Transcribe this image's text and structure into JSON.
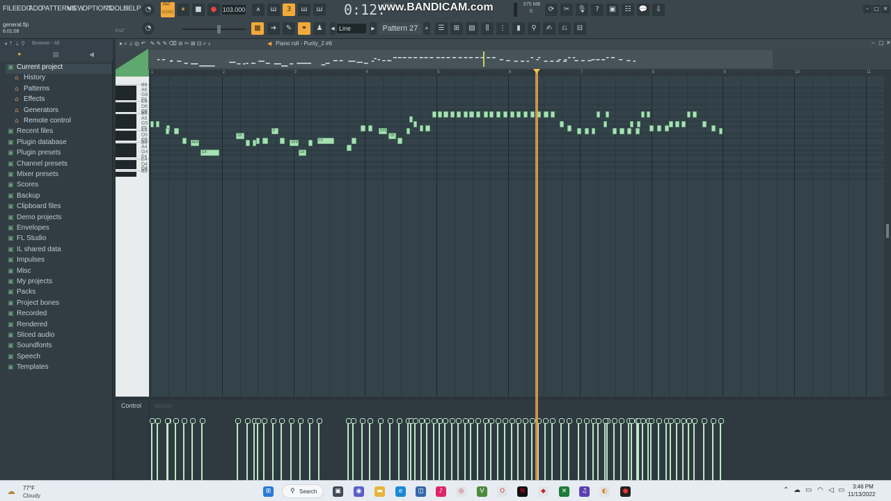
{
  "menu": [
    "FILE",
    "EDIT",
    "ADD",
    "PATTERNS",
    "VIEW",
    "OPTIONS",
    "TOOLS",
    "HELP"
  ],
  "transport": {
    "pat_label": "PAT",
    "song_label": "SONG",
    "tempo": "103.000",
    "time": "0:12:",
    "time_sub": "M:S:CS",
    "memory": "575 MB",
    "memory_sub": "0"
  },
  "watermark": "www.BANDICAM.com",
  "project": {
    "file": "general.flp",
    "position": "6:01:08",
    "hint_time": "0'12''"
  },
  "toolbar2": {
    "snap": "Line",
    "pattern": "Pattern 27"
  },
  "browser": {
    "header": "Browser - All",
    "items": [
      {
        "label": "Current project",
        "type": "root"
      },
      {
        "label": "History",
        "type": "sub"
      },
      {
        "label": "Patterns",
        "type": "sub"
      },
      {
        "label": "Effects",
        "type": "sub"
      },
      {
        "label": "Generators",
        "type": "sub"
      },
      {
        "label": "Remote control",
        "type": "sub"
      },
      {
        "label": "Recent files",
        "type": "root"
      },
      {
        "label": "Plugin database",
        "type": "root"
      },
      {
        "label": "Plugin presets",
        "type": "root"
      },
      {
        "label": "Channel presets",
        "type": "root"
      },
      {
        "label": "Mixer presets",
        "type": "root"
      },
      {
        "label": "Scores",
        "type": "root"
      },
      {
        "label": "Backup",
        "type": "root"
      },
      {
        "label": "Clipboard files",
        "type": "root"
      },
      {
        "label": "Demo projects",
        "type": "root"
      },
      {
        "label": "Envelopes",
        "type": "root"
      },
      {
        "label": "FL Studio",
        "type": "root"
      },
      {
        "label": "IL shared data",
        "type": "root"
      },
      {
        "label": "Impulses",
        "type": "root"
      },
      {
        "label": "Misc",
        "type": "root"
      },
      {
        "label": "My projects",
        "type": "root"
      },
      {
        "label": "Packs",
        "type": "root"
      },
      {
        "label": "Project bones",
        "type": "root"
      },
      {
        "label": "Recorded",
        "type": "root"
      },
      {
        "label": "Rendered",
        "type": "root"
      },
      {
        "label": "Sliced audio",
        "type": "root"
      },
      {
        "label": "Soundfonts",
        "type": "root"
      },
      {
        "label": "Speech",
        "type": "root"
      },
      {
        "label": "Templates",
        "type": "root"
      }
    ]
  },
  "piano_roll": {
    "title": "Piano roll - Purity_2 #6",
    "bars": [
      "1",
      "2",
      "3",
      "4",
      "5",
      "6",
      "7",
      "8",
      "9",
      "10",
      "11"
    ],
    "key_labels": [
      "B6",
      "A6",
      "G6",
      "F6",
      "E6",
      "D6",
      "C6",
      "B5",
      "A5",
      "G5",
      "F5",
      "E5",
      "D5",
      "C5",
      "B4",
      "A4",
      "G4",
      "F4",
      "E4",
      "D4",
      "C4",
      "B3"
    ],
    "playhead_bar": 6.4,
    "notes": [
      {
        "label": "",
        "bar": 1.0,
        "len": 0.04,
        "pitch": "G5"
      },
      {
        "label": "",
        "bar": 1.08,
        "len": 0.05,
        "pitch": "G5"
      },
      {
        "label": "",
        "bar": 1.22,
        "len": 0.04,
        "pitch": "F5"
      },
      {
        "label": "",
        "bar": 1.21,
        "len": 0.04,
        "pitch": "E5"
      },
      {
        "label": "",
        "bar": 1.33,
        "len": 0.07,
        "pitch": "E5"
      },
      {
        "label": "",
        "bar": 1.45,
        "len": 0.06,
        "pitch": "C5"
      },
      {
        "label": "A#4",
        "bar": 1.56,
        "len": 0.12,
        "pitch": "B4"
      },
      {
        "label": "G4",
        "bar": 1.7,
        "len": 0.26,
        "pitch": "G4"
      },
      {
        "label": "D5",
        "bar": 2.2,
        "len": 0.11,
        "pitch": "D5"
      },
      {
        "label": "",
        "bar": 2.33,
        "len": 0.06,
        "pitch": "B4"
      },
      {
        "label": "",
        "bar": 2.43,
        "len": 0.04,
        "pitch": "B4"
      },
      {
        "label": "",
        "bar": 2.48,
        "len": 0.04,
        "pitch": "C5"
      },
      {
        "label": "",
        "bar": 2.57,
        "len": 0.07,
        "pitch": "C5"
      },
      {
        "label": "D",
        "bar": 2.69,
        "len": 0.1,
        "pitch": "E5"
      },
      {
        "label": "",
        "bar": 2.81,
        "len": 0.07,
        "pitch": "C5"
      },
      {
        "label": "A#4",
        "bar": 2.95,
        "len": 0.12,
        "pitch": "B4"
      },
      {
        "label": "G4",
        "bar": 3.07,
        "len": 0.11,
        "pitch": "G4"
      },
      {
        "label": "",
        "bar": 3.21,
        "len": 0.06,
        "pitch": "B4"
      },
      {
        "label": "C5",
        "bar": 3.33,
        "len": 0.24,
        "pitch": "C5"
      },
      {
        "label": "",
        "bar": 3.74,
        "len": 0.07,
        "pitch": "A4"
      },
      {
        "label": "",
        "bar": 3.81,
        "len": 0.07,
        "pitch": "C5"
      },
      {
        "label": "",
        "bar": 3.94,
        "len": 0.07,
        "pitch": "F5"
      },
      {
        "label": "",
        "bar": 4.04,
        "len": 0.06,
        "pitch": "F5"
      },
      {
        "label": "D#5",
        "bar": 4.19,
        "len": 0.12,
        "pitch": "E5"
      },
      {
        "label": "D5",
        "bar": 4.33,
        "len": 0.1,
        "pitch": "D5"
      },
      {
        "label": "",
        "bar": 4.45,
        "len": 0.07,
        "pitch": "C5"
      },
      {
        "label": "",
        "bar": 4.58,
        "len": 0.04,
        "pitch": "E5"
      },
      {
        "label": "",
        "bar": 4.62,
        "len": 0.04,
        "pitch": "A5"
      },
      {
        "label": "",
        "bar": 4.68,
        "len": 0.04,
        "pitch": "G5"
      },
      {
        "label": "",
        "bar": 4.76,
        "len": 0.05,
        "pitch": "F5"
      },
      {
        "label": "",
        "bar": 4.84,
        "len": 0.07,
        "pitch": "F5"
      },
      {
        "label": "",
        "bar": 4.94,
        "len": 0.06,
        "pitch": "B5"
      },
      {
        "label": "",
        "bar": 5.02,
        "len": 0.06,
        "pitch": "B5"
      },
      {
        "label": "",
        "bar": 5.1,
        "len": 0.06,
        "pitch": "B5"
      },
      {
        "label": "",
        "bar": 5.19,
        "len": 0.06,
        "pitch": "B5"
      },
      {
        "label": "",
        "bar": 5.28,
        "len": 0.06,
        "pitch": "B5"
      },
      {
        "label": "",
        "bar": 5.38,
        "len": 0.06,
        "pitch": "B5"
      },
      {
        "label": "",
        "bar": 5.46,
        "len": 0.06,
        "pitch": "B5"
      },
      {
        "label": "",
        "bar": 5.55,
        "len": 0.06,
        "pitch": "B5"
      },
      {
        "label": "",
        "bar": 5.66,
        "len": 0.06,
        "pitch": "B5"
      },
      {
        "label": "",
        "bar": 5.74,
        "len": 0.06,
        "pitch": "B5"
      },
      {
        "label": "",
        "bar": 5.83,
        "len": 0.06,
        "pitch": "B5"
      },
      {
        "label": "",
        "bar": 5.93,
        "len": 0.06,
        "pitch": "B5"
      },
      {
        "label": "",
        "bar": 6.03,
        "len": 0.06,
        "pitch": "B5"
      },
      {
        "label": "",
        "bar": 6.12,
        "len": 0.06,
        "pitch": "B5"
      },
      {
        "label": "",
        "bar": 6.21,
        "len": 0.06,
        "pitch": "B5"
      },
      {
        "label": "",
        "bar": 6.31,
        "len": 0.06,
        "pitch": "B5"
      },
      {
        "label": "",
        "bar": 6.4,
        "len": 0.06,
        "pitch": "B5"
      },
      {
        "label": "",
        "bar": 6.5,
        "len": 0.06,
        "pitch": "B5"
      },
      {
        "label": "",
        "bar": 6.59,
        "len": 0.06,
        "pitch": "B5"
      },
      {
        "label": "",
        "bar": 6.72,
        "len": 0.06,
        "pitch": "G5"
      },
      {
        "label": "",
        "bar": 6.83,
        "len": 0.06,
        "pitch": "F5"
      },
      {
        "label": "",
        "bar": 6.96,
        "len": 0.06,
        "pitch": "E5"
      },
      {
        "label": "",
        "bar": 7.07,
        "len": 0.06,
        "pitch": "E5"
      },
      {
        "label": "",
        "bar": 7.17,
        "len": 0.04,
        "pitch": "E5"
      },
      {
        "label": "",
        "bar": 7.24,
        "len": 0.04,
        "pitch": "B5"
      },
      {
        "label": "",
        "bar": 7.36,
        "len": 0.04,
        "pitch": "B5"
      },
      {
        "label": "",
        "bar": 7.33,
        "len": 0.04,
        "pitch": "G5"
      },
      {
        "label": "",
        "bar": 7.46,
        "len": 0.06,
        "pitch": "E5"
      },
      {
        "label": "",
        "bar": 7.56,
        "len": 0.06,
        "pitch": "E5"
      },
      {
        "label": "",
        "bar": 7.66,
        "len": 0.06,
        "pitch": "E5"
      },
      {
        "label": "",
        "bar": 7.7,
        "len": 0.04,
        "pitch": "G5"
      },
      {
        "label": "",
        "bar": 7.78,
        "len": 0.06,
        "pitch": "E5"
      },
      {
        "label": "",
        "bar": 7.8,
        "len": 0.04,
        "pitch": "G5"
      },
      {
        "label": "",
        "bar": 7.86,
        "len": 0.04,
        "pitch": "B5"
      },
      {
        "label": "",
        "bar": 7.94,
        "len": 0.04,
        "pitch": "B5"
      },
      {
        "label": "",
        "bar": 7.97,
        "len": 0.06,
        "pitch": "F5"
      },
      {
        "label": "",
        "bar": 8.08,
        "len": 0.06,
        "pitch": "F5"
      },
      {
        "label": "",
        "bar": 8.19,
        "len": 0.06,
        "pitch": "F5"
      },
      {
        "label": "",
        "bar": 8.25,
        "len": 0.06,
        "pitch": "G5"
      },
      {
        "label": "",
        "bar": 8.33,
        "len": 0.06,
        "pitch": "G5"
      },
      {
        "label": "",
        "bar": 8.42,
        "len": 0.06,
        "pitch": "G5"
      },
      {
        "label": "",
        "bar": 8.5,
        "len": 0.04,
        "pitch": "B5"
      },
      {
        "label": "",
        "bar": 8.58,
        "len": 0.06,
        "pitch": "B5"
      },
      {
        "label": "",
        "bar": 8.71,
        "len": 0.06,
        "pitch": "G5"
      },
      {
        "label": "",
        "bar": 8.84,
        "len": 0.06,
        "pitch": "F5"
      },
      {
        "label": "",
        "bar": 8.95,
        "len": 0.04,
        "pitch": "E5"
      }
    ]
  },
  "control": {
    "label": "Control",
    "sub_label": "Velocity"
  },
  "taskbar": {
    "weather_temp": "77°F",
    "weather_desc": "Cloudy",
    "search": "Search",
    "time": "3:46 PM",
    "date": "11/13/2022"
  }
}
